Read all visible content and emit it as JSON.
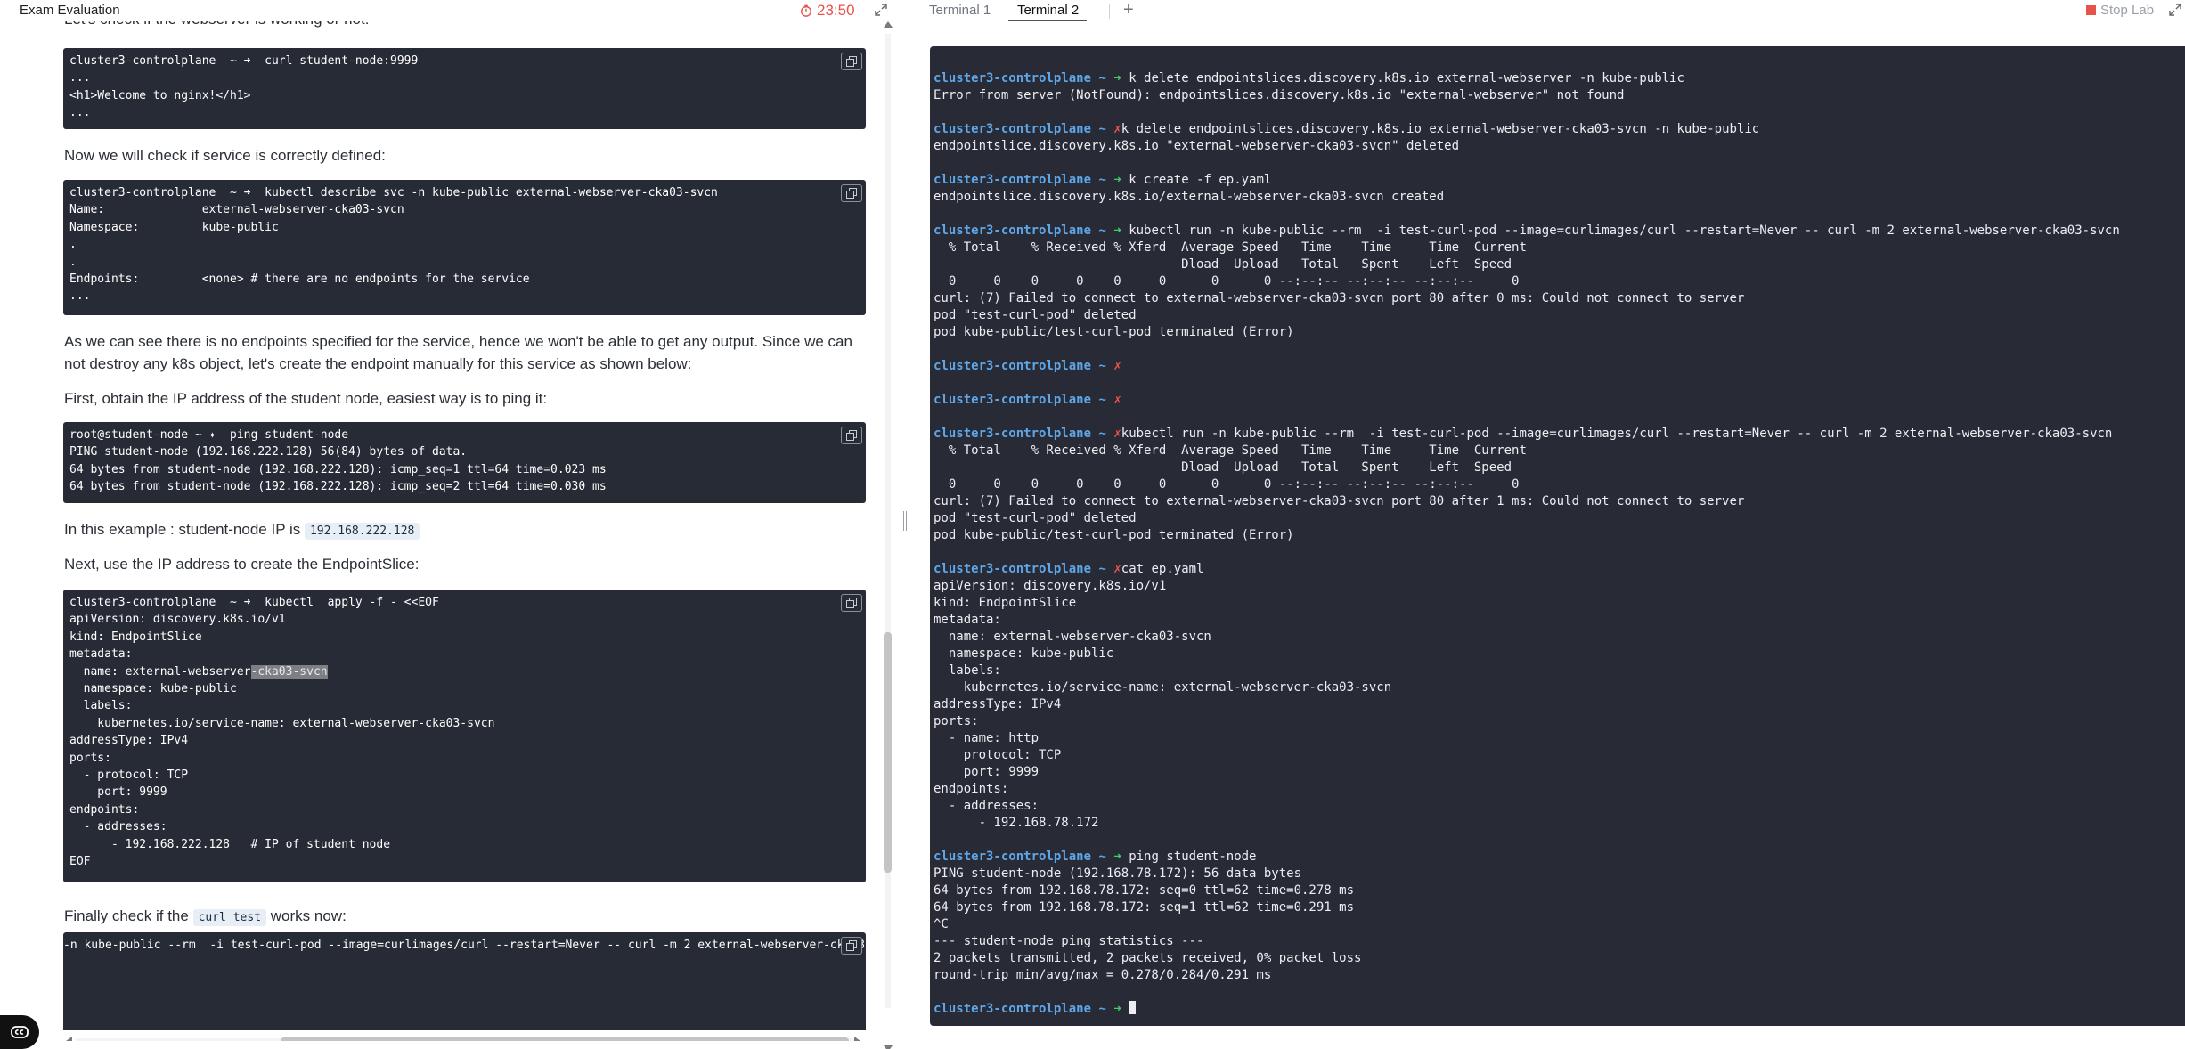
{
  "left_pane": {
    "title": "Exam Evaluation",
    "timer": "23:50",
    "intro_partial": "Let's check if the webserver is working or not:",
    "blocks": {
      "curl_9999": "cluster3-controlplane  ~ ➜  curl student-node:9999\n...\n<h1>Welcome to nginx!</h1>\n...",
      "describe_svc": "cluster3-controlplane  ~ ➜  kubectl describe svc -n kube-public external-webserver-cka03-svcn\nName:              external-webserver-cka03-svcn\nNamespace:         kube-public\n.\n.\nEndpoints:         <none> # there are no endpoints for the service\n...",
      "ping": "root@student-node ~ ✦  ping student-node\nPING student-node (192.168.222.128) 56(84) bytes of data.\n64 bytes from student-node (192.168.222.128): icmp_seq=1 ttl=64 time=0.023 ms\n64 bytes from student-node (192.168.222.128): icmp_seq=2 ttl=64 time=0.030 ms",
      "apply_before_sel": "cluster3-controlplane  ~ ➜  kubectl  apply -f - <<EOF\napiVersion: discovery.k8s.io/v1\nkind: EndpointSlice\nmetadata:\n  name: external-webserver",
      "apply_selected": "-cka03-svcn",
      "apply_after_sel": "\n  namespace: kube-public\n  labels:\n    kubernetes.io/service-name: external-webserver-cka03-svcn\naddressType: IPv4\nports:\n  - protocol: TCP\n    port: 9999\nendpoints:\n  - addresses:\n      - 192.168.222.128   # IP of student node\nEOF",
      "curl_test_cmd": "-n kube-public --rm  -i test-curl-pod --image=curlimages/curl --restart=Never -- curl -m 2 external-webserver-cka03-s"
    },
    "para_check_service": "Now we will check if service is correctly defined:",
    "para_no_endpoints": "As we can see there is no endpoints specified for the service, hence we won't be able to get any output. Since we can not destroy any k8s object, let's create the endpoint manually for this service as shown below:",
    "para_obtain_ip": "First, obtain the IP address of the student node, easiest way is to ping it:",
    "para_example_prefix": "In this example : student-node IP is",
    "para_example_ip": "192.168.222.128",
    "para_next": "Next, use the IP address to create the EndpointSlice:",
    "para_finally_prefix": "Finally check if the",
    "para_finally_code": "curl test",
    "para_finally_suffix": "works now:"
  },
  "right_pane": {
    "tabs": [
      {
        "label": "Terminal 1"
      },
      {
        "label": "Terminal 2"
      }
    ],
    "add_tab": "+",
    "stop_lab": "Stop Lab",
    "prompt_host": "cluster3-controlplane",
    "prompt_dir": "~",
    "ok_glyph": "➜",
    "err_glyph": "✗",
    "terminal": {
      "cmd1": " k delete endpointslices.discovery.k8s.io external-webserver -n kube-public",
      "out1": "Error from server (NotFound): endpointslices.discovery.k8s.io \"external-webserver\" not found",
      "cmd2": "k delete endpointslices.discovery.k8s.io external-webserver-cka03-svcn -n kube-public",
      "out2": "endpointslice.discovery.k8s.io \"external-webserver-cka03-svcn\" deleted",
      "cmd3": " k create -f ep.yaml",
      "out3": "endpointslice.discovery.k8s.io/external-webserver-cka03-svcn created",
      "cmd4": " kubectl run -n kube-public --rm  -i test-curl-pod --image=curlimages/curl --restart=Never -- curl -m 2 external-webserver-cka03-svcn",
      "out4": "  % Total    % Received % Xferd  Average Speed   Time    Time     Time  Current\n                                 Dload  Upload   Total   Spent    Left  Speed\n  0     0    0     0    0     0      0      0 --:--:-- --:--:-- --:--:--     0\ncurl: (7) Failed to connect to external-webserver-cka03-svcn port 80 after 0 ms: Could not connect to server\npod \"test-curl-pod\" deleted\npod kube-public/test-curl-pod terminated (Error)",
      "cmd7": "kubectl run -n kube-public --rm  -i test-curl-pod --image=curlimages/curl --restart=Never -- curl -m 2 external-webserver-cka03-svcn",
      "out7": "  % Total    % Received % Xferd  Average Speed   Time    Time     Time  Current\n                                 Dload  Upload   Total   Spent    Left  Speed\n  0     0    0     0    0     0      0      0 --:--:-- --:--:-- --:--:--     0\ncurl: (7) Failed to connect to external-webserver-cka03-svcn port 80 after 1 ms: Could not connect to server\npod \"test-curl-pod\" deleted\npod kube-public/test-curl-pod terminated (Error)",
      "cmd8": "cat ep.yaml",
      "out8": "apiVersion: discovery.k8s.io/v1\nkind: EndpointSlice\nmetadata:\n  name: external-webserver-cka03-svcn\n  namespace: kube-public\n  labels:\n    kubernetes.io/service-name: external-webserver-cka03-svcn\naddressType: IPv4\nports:\n  - name: http\n    protocol: TCP\n    port: 9999\nendpoints:\n  - addresses:\n      - 192.168.78.172",
      "cmd9": " ping student-node",
      "out9": "PING student-node (192.168.78.172): 56 data bytes\n64 bytes from 192.168.78.172: seq=0 ttl=62 time=0.278 ms\n64 bytes from 192.168.78.172: seq=1 ttl=62 time=0.291 ms\n^C\n--- student-node ping statistics ---\n2 packets transmitted, 2 packets received, 0% packet loss\nround-trip min/avg/max = 0.278/0.284/0.291 ms"
    }
  },
  "colors": {
    "timer": "#e5534b",
    "terminal_bg": "#282b35",
    "code_bg": "#272b35",
    "prompt": "#5ea6e8",
    "ok": "#3ecf6b",
    "err": "#ef5350",
    "stop": "#e5534b"
  },
  "icons": {
    "timer": "stopwatch-icon",
    "expand": "expand-arrows-icon",
    "copy": "copy-icon",
    "captions": "closed-captions-icon",
    "stop": "stop-square-icon"
  }
}
